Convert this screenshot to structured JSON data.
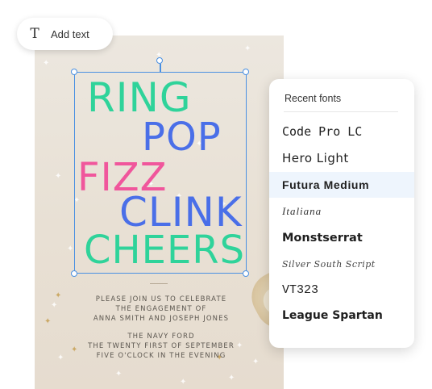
{
  "toolbar": {
    "add_text_icon": "text-t-icon",
    "add_text_glyph": "T",
    "add_text_label": "Add text"
  },
  "card": {
    "headline_words": [
      "RING",
      "POP",
      "FIZZ",
      "CLINK",
      "CHEERS"
    ],
    "colors": {
      "green": "#2fd39a",
      "blue": "#4a6fe8",
      "pink": "#f0569c",
      "selection": "#4a90e2"
    },
    "invitation_lines": [
      "PLEASE JOIN US TO CELEBRATE",
      "THE ENGAGEMENT OF",
      "ANNA SMITH AND JOSEPH JONES",
      "THE NAVY FORD",
      "THE TWENTY FIRST OF SEPTEMBER",
      "FIVE O'CLOCK IN THE EVENING"
    ]
  },
  "fonts_panel": {
    "title": "Recent fonts",
    "items": [
      "Code Pro LC",
      "Hero Light",
      "Futura Medium",
      "Italiana",
      "Monstserrat",
      "Silver South Script",
      "VT323",
      "League Spartan"
    ],
    "highlighted": "Futura Medium"
  }
}
